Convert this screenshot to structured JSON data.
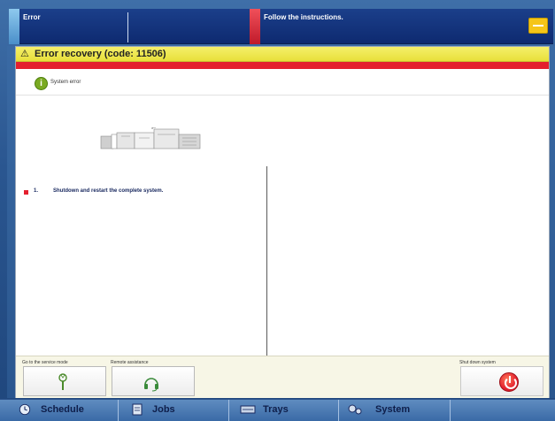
{
  "topbar": {
    "status_label": "Error",
    "message": "Follow the instructions."
  },
  "dialog": {
    "title": "Error recovery  (code: 11506)",
    "info_text": "System error",
    "steps": [
      {
        "number": "1.",
        "text": "Shutdown and restart the complete system."
      }
    ]
  },
  "actions": {
    "service_mode_label": "Go to the service mode",
    "remote_assistance_label": "Remote assistance",
    "shutdown_label": "Shut down system"
  },
  "nav": {
    "items": [
      {
        "label": "Schedule",
        "icon": "schedule-icon"
      },
      {
        "label": "Jobs",
        "icon": "jobs-icon"
      },
      {
        "label": "Trays",
        "icon": "trays-icon"
      },
      {
        "label": "System",
        "icon": "system-icon"
      }
    ]
  },
  "colors": {
    "header_yellow": "#e8e03a",
    "alert_red": "#e4202e",
    "top_blue": "#0e2a70",
    "nav_blue": "#3a6aa6"
  }
}
